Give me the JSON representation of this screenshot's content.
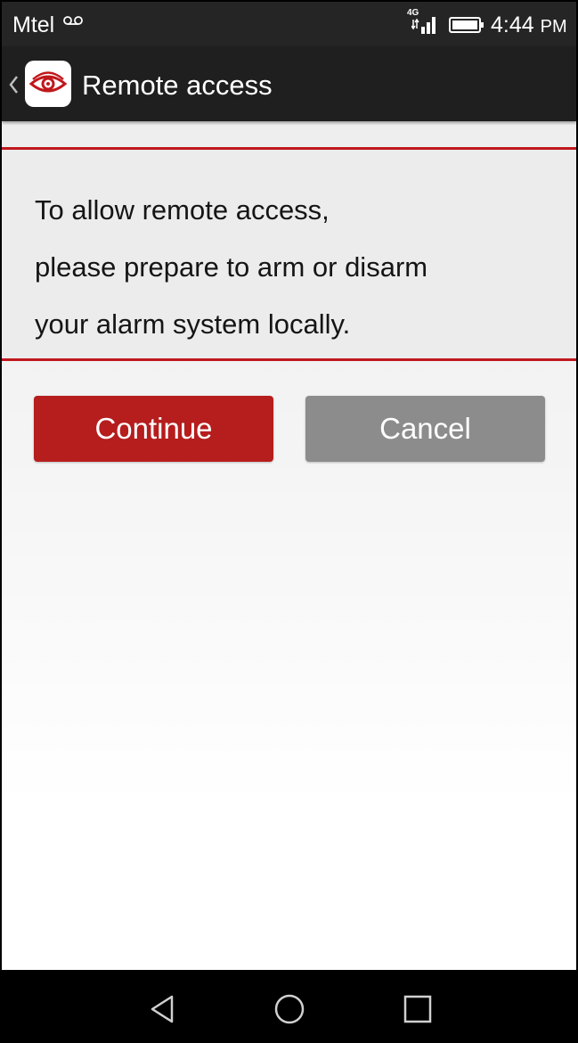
{
  "status_bar": {
    "carrier": "Mtel",
    "network_type": "4G",
    "time": "4:44",
    "time_suffix": "PM",
    "icons": [
      "voicemail-icon",
      "signal-icon",
      "battery-icon"
    ]
  },
  "action_bar": {
    "title": "Remote access",
    "icons": [
      "back-icon",
      "app-eye-icon"
    ]
  },
  "message": {
    "line1": "To allow remote access,",
    "line2": "please prepare to arm or disarm",
    "line3": "your alarm system locally."
  },
  "buttons": {
    "continue_label": "Continue",
    "cancel_label": "Cancel"
  },
  "nav_bar": {
    "icons": [
      "nav-back-icon",
      "nav-home-icon",
      "nav-recent-apps-icon"
    ]
  },
  "colors": {
    "accent_red": "#b61d1d",
    "divider_red": "#c0181c",
    "cancel_gray": "#8c8c8c",
    "bar_dark": "#1f1f1f"
  }
}
